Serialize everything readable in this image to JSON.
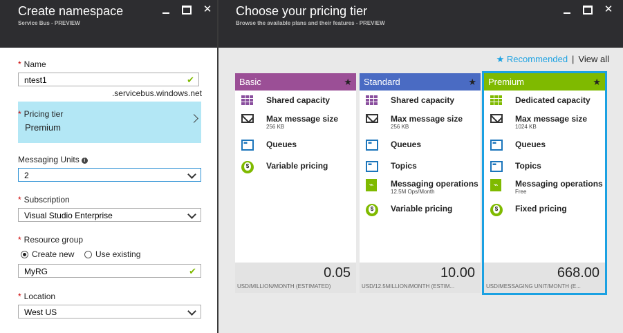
{
  "left_blade": {
    "title": "Create namespace",
    "subtitle": "Service Bus - PREVIEW",
    "name": {
      "label": "Name",
      "value": "ntest1",
      "suffix": ".servicebus.windows.net"
    },
    "pricing_tier": {
      "label": "Pricing tier",
      "value": "Premium"
    },
    "messaging_units": {
      "label": "Messaging Units",
      "value": "2"
    },
    "subscription": {
      "label": "Subscription",
      "value": "Visual Studio Enterprise"
    },
    "resource_group": {
      "label": "Resource group",
      "opt_new": "Create new",
      "opt_existing": "Use existing",
      "selected": "Create new",
      "value": "MyRG"
    },
    "location": {
      "label": "Location",
      "value": "West US"
    }
  },
  "right_blade": {
    "title": "Choose your pricing tier",
    "subtitle": "Browse the available plans and their features - PREVIEW",
    "recommended_label": "Recommended",
    "separator": "|",
    "view_all_label": "View all"
  },
  "cards": [
    {
      "name": "Basic",
      "color": "#9b4f96",
      "features": [
        {
          "icon": "shared-capacity-icon",
          "name": "Shared capacity",
          "detail": ""
        },
        {
          "icon": "mail-icon",
          "name": "Max message size",
          "detail": "256 KB"
        },
        {
          "icon": "queue-icon",
          "name": "Queues",
          "detail": ""
        },
        {
          "icon": "pricing-coin-icon",
          "name": "Variable pricing",
          "detail": ""
        }
      ],
      "price": "0.05",
      "unit": "USD/MILLION/MONTH (ESTIMATED)"
    },
    {
      "name": "Standard",
      "color": "#4a6bc3",
      "features": [
        {
          "icon": "shared-capacity-icon",
          "name": "Shared capacity",
          "detail": ""
        },
        {
          "icon": "mail-icon",
          "name": "Max message size",
          "detail": "256 KB"
        },
        {
          "icon": "queue-icon",
          "name": "Queues",
          "detail": ""
        },
        {
          "icon": "topic-icon",
          "name": "Topics",
          "detail": ""
        },
        {
          "icon": "messaging-ops-icon",
          "name": "Messaging operations",
          "detail": "12.5M Ops/Month"
        },
        {
          "icon": "pricing-coin-icon",
          "name": "Variable pricing",
          "detail": ""
        }
      ],
      "price": "10.00",
      "unit": "USD/12.5MILLION/MONTH (ESTIM..."
    },
    {
      "name": "Premium",
      "color": "#7fba00",
      "features": [
        {
          "icon": "dedicated-capacity-icon",
          "name": "Dedicated capacity",
          "detail": ""
        },
        {
          "icon": "mail-icon",
          "name": "Max message size",
          "detail": "1024 KB"
        },
        {
          "icon": "queue-icon",
          "name": "Queues",
          "detail": ""
        },
        {
          "icon": "topic-icon",
          "name": "Topics",
          "detail": ""
        },
        {
          "icon": "messaging-ops-icon",
          "name": "Messaging operations",
          "detail": "Free"
        },
        {
          "icon": "pricing-coin-icon",
          "name": "Fixed pricing",
          "detail": ""
        }
      ],
      "price": "668.00",
      "unit": "USD/MESSAGING UNIT/MONTH (E..."
    }
  ]
}
